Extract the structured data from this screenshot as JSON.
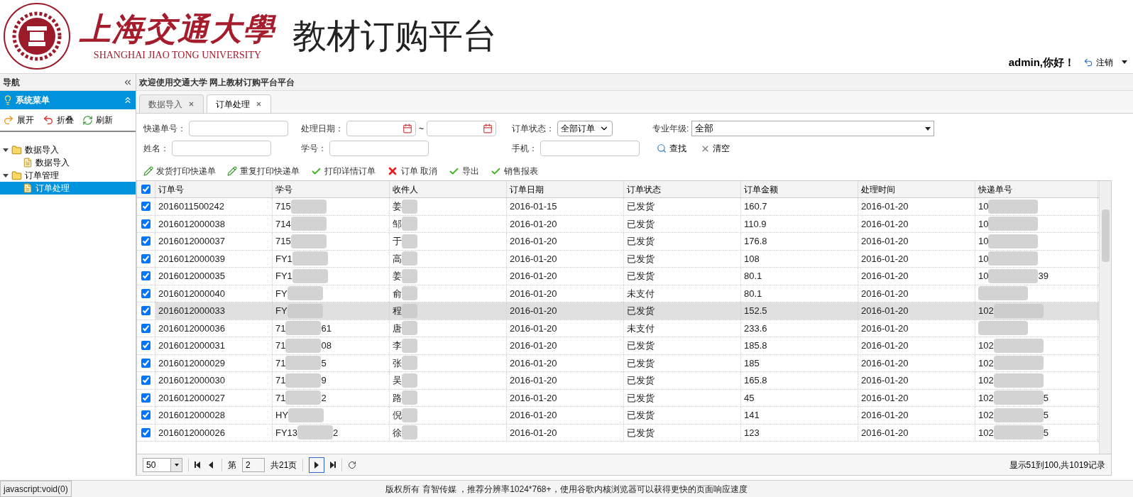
{
  "header": {
    "logo_cn": "上海交通大學",
    "logo_en": "SHANGHAI JIAO TONG UNIVERSITY",
    "title": "教材订购平台",
    "greeting": "admin,你好！",
    "logout": "注销"
  },
  "nav": {
    "title": "导航",
    "menu_title": "系统菜单",
    "actions": [
      {
        "kind": "expand",
        "label": "展开"
      },
      {
        "kind": "collapse",
        "label": "折叠"
      },
      {
        "kind": "refresh",
        "label": "刷新"
      }
    ],
    "tree": [
      {
        "label": "数据导入",
        "expanded": true,
        "children": [
          {
            "label": "数据导入",
            "selected": false
          }
        ]
      },
      {
        "label": "订单管理",
        "expanded": true,
        "children": [
          {
            "label": "订单处理",
            "selected": true
          }
        ]
      }
    ]
  },
  "welcome": "欢迎使用交通大学 网上教材订购平台平台",
  "tabs": [
    {
      "label": "数据导入",
      "selected": false
    },
    {
      "label": "订单处理",
      "selected": true
    }
  ],
  "filters": {
    "express_no": {
      "label": "快递单号："
    },
    "date": {
      "label": "处理日期：",
      "separator": "~"
    },
    "status": {
      "label": "订单状态：",
      "value": "全部订单"
    },
    "major": {
      "label": "专业年级:",
      "value": "全部"
    },
    "name": {
      "label": "姓名："
    },
    "student_id": {
      "label": "学号："
    },
    "phone": {
      "label": "手机："
    },
    "search": "查找",
    "clear": "清空"
  },
  "toolbar": [
    {
      "kind": "pencil",
      "label": "发货打印快递单"
    },
    {
      "kind": "pencil",
      "label": "重复打印快递单"
    },
    {
      "kind": "check",
      "label": "打印详情订单"
    },
    {
      "kind": "cross",
      "label": "订单 取消"
    },
    {
      "kind": "check",
      "label": "导出"
    },
    {
      "kind": "check",
      "label": "销售报表"
    }
  ],
  "table": {
    "all_checked": true,
    "columns": [
      "订单号",
      "学号",
      "收件人",
      "订单日期",
      "订单状态",
      "订单金额",
      "处理时间",
      "快递单号"
    ],
    "rows": [
      {
        "checked": true,
        "selected": false,
        "order_no": "2016011500242",
        "student_id": "715",
        "student_id_end": "",
        "recipient": "姜",
        "date": "2016-01-15",
        "status": "已发货",
        "amount": "160.7",
        "processed": "2016-01-20",
        "express": "10",
        "express_end": ""
      },
      {
        "checked": true,
        "selected": false,
        "order_no": "2016012000038",
        "student_id": "714",
        "student_id_end": "",
        "recipient": "邹",
        "date": "2016-01-20",
        "status": "已发货",
        "amount": "110.9",
        "processed": "2016-01-20",
        "express": "10",
        "express_end": ""
      },
      {
        "checked": true,
        "selected": false,
        "order_no": "2016012000037",
        "student_id": "715",
        "student_id_end": "",
        "recipient": "于",
        "date": "2016-01-20",
        "status": "已发货",
        "amount": "176.8",
        "processed": "2016-01-20",
        "express": "10",
        "express_end": ""
      },
      {
        "checked": true,
        "selected": false,
        "order_no": "2016012000039",
        "student_id": "FY1",
        "student_id_end": "",
        "recipient": "高",
        "date": "2016-01-20",
        "status": "已发货",
        "amount": "108",
        "processed": "2016-01-20",
        "express": "10",
        "express_end": ""
      },
      {
        "checked": true,
        "selected": false,
        "order_no": "2016012000035",
        "student_id": "FY1",
        "student_id_end": "",
        "recipient": "姜",
        "date": "2016-01-20",
        "status": "已发货",
        "amount": "80.1",
        "processed": "2016-01-20",
        "express": "10",
        "express_end": "39"
      },
      {
        "checked": true,
        "selected": false,
        "order_no": "2016012000040",
        "student_id": "FY",
        "student_id_end": "",
        "recipient": "俞",
        "date": "2016-01-20",
        "status": "未支付",
        "amount": "80.1",
        "processed": "2016-01-20",
        "express": "",
        "express_end": ""
      },
      {
        "checked": true,
        "selected": true,
        "order_no": "2016012000033",
        "student_id": "FY",
        "student_id_end": "",
        "recipient": "程",
        "date": "2016-01-20",
        "status": "已发货",
        "amount": "152.5",
        "processed": "2016-01-20",
        "express": "102",
        "express_end": ""
      },
      {
        "checked": true,
        "selected": false,
        "order_no": "2016012000036",
        "student_id": "71",
        "student_id_end": "61",
        "recipient": "唐",
        "date": "2016-01-20",
        "status": "未支付",
        "amount": "233.6",
        "processed": "2016-01-20",
        "express": "",
        "express_end": ""
      },
      {
        "checked": true,
        "selected": false,
        "order_no": "2016012000031",
        "student_id": "71",
        "student_id_end": "08",
        "recipient": "李",
        "date": "2016-01-20",
        "status": "已发货",
        "amount": "185.8",
        "processed": "2016-01-20",
        "express": "102",
        "express_end": ""
      },
      {
        "checked": true,
        "selected": false,
        "order_no": "2016012000029",
        "student_id": "71",
        "student_id_end": "5",
        "recipient": "张",
        "date": "2016-01-20",
        "status": "已发货",
        "amount": "185",
        "processed": "2016-01-20",
        "express": "102",
        "express_end": ""
      },
      {
        "checked": true,
        "selected": false,
        "order_no": "2016012000030",
        "student_id": "71",
        "student_id_end": "9",
        "recipient": "吴",
        "date": "2016-01-20",
        "status": "已发货",
        "amount": "165.8",
        "processed": "2016-01-20",
        "express": "102",
        "express_end": ""
      },
      {
        "checked": true,
        "selected": false,
        "order_no": "2016012000027",
        "student_id": "71",
        "student_id_end": "2",
        "recipient": "路",
        "date": "2016-01-20",
        "status": "已发货",
        "amount": "45",
        "processed": "2016-01-20",
        "express": "102",
        "express_end": "5"
      },
      {
        "checked": true,
        "selected": false,
        "order_no": "2016012000028",
        "student_id": "HY",
        "student_id_end": "",
        "recipient": "倪",
        "date": "2016-01-20",
        "status": "已发货",
        "amount": "141",
        "processed": "2016-01-20",
        "express": "102",
        "express_end": "5"
      },
      {
        "checked": true,
        "selected": false,
        "order_no": "2016012000026",
        "student_id": "FY13",
        "student_id_end": "2",
        "recipient": "徐",
        "date": "2016-01-20",
        "status": "已发货",
        "amount": "123",
        "processed": "2016-01-20",
        "express": "102",
        "express_end": "5"
      }
    ]
  },
  "pager": {
    "page_size": "50",
    "page_prefix": "第",
    "page": "2",
    "page_total": "共21页",
    "summary": "显示51到100,共1019记录"
  },
  "footer": "版权所有 育智传媒 ，推荐分辨率1024*768+，使用谷歌内核浏览器可以获得更快的页面响应速度",
  "status_url": "javascript:void(0)"
}
